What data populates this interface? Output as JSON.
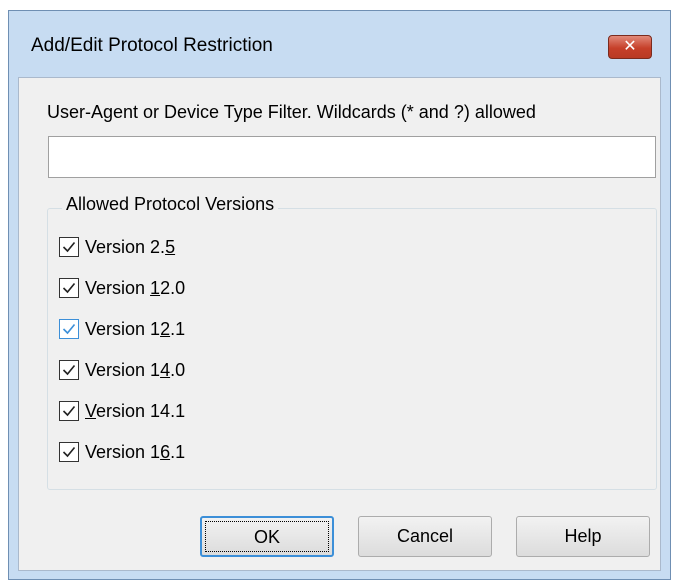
{
  "window": {
    "title": "Add/Edit Protocol Restriction",
    "close_glyph": "✕"
  },
  "filter": {
    "label": "User-Agent or Device Type Filter. Wildcards (* and ?) allowed",
    "value": ""
  },
  "group": {
    "label": "Allowed Protocol Versions",
    "versions": [
      {
        "pre": "Version 2.",
        "ul": "5",
        "post": "",
        "checked": true,
        "focused": false
      },
      {
        "pre": "Version ",
        "ul": "1",
        "post": "2.0",
        "checked": true,
        "focused": false
      },
      {
        "pre": "Version 1",
        "ul": "2",
        "post": ".1",
        "checked": true,
        "focused": true
      },
      {
        "pre": "Version 1",
        "ul": "4",
        "post": ".0",
        "checked": true,
        "focused": false
      },
      {
        "pre": "",
        "ul": "V",
        "post": "ersion 14.1",
        "checked": true,
        "focused": false
      },
      {
        "pre": "Version 1",
        "ul": "6",
        "post": ".1",
        "checked": true,
        "focused": false
      }
    ]
  },
  "buttons": {
    "ok": "OK",
    "cancel": "Cancel",
    "help": "Help"
  },
  "colors": {
    "accent": "#3c8fd8",
    "titlebar": "#c7dcf2",
    "close": "#c6402a"
  },
  "icons": {
    "close": "close-icon",
    "check": "checkmark-icon"
  }
}
